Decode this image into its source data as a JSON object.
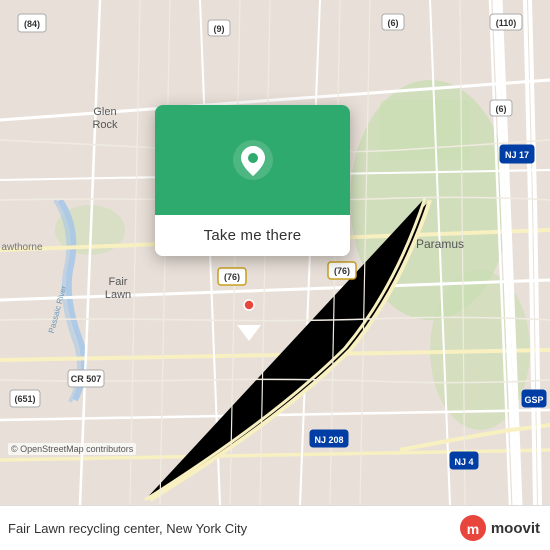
{
  "map": {
    "attribution": "© OpenStreetMap contributors"
  },
  "popup": {
    "button_label": "Take me there"
  },
  "bottom_bar": {
    "location_title": "Fair Lawn recycling center, New York City",
    "brand_name": "moovit"
  },
  "labels": {
    "glen_rock": "Glen Rock",
    "fair_lawn": "Fair Lawn",
    "paramus": "Paramus",
    "hawthorne": "awthorne",
    "route_84": "(84)",
    "route_9": "(9)",
    "route_6_top": "(6)",
    "route_110": "(110)",
    "route_6_mid": "(6)",
    "route_76_left": "(76)",
    "route_76_right": "(76)",
    "route_17": "NJ 17",
    "route_208": "NJ 208",
    "route_4": "NJ 4",
    "route_gsp": "GSP",
    "route_cr507": "CR 507",
    "route_651": "(651)",
    "passaic_river": "Passaic River"
  },
  "colors": {
    "map_bg": "#e8e0d8",
    "road_major": "#ffffff",
    "road_minor": "#f5f0e8",
    "road_yellow": "#f0c040",
    "green_area": "#c8ddb0",
    "water": "#a8c8e8",
    "popup_green": "#2eaa6e",
    "accent_red": "#e8453c"
  }
}
